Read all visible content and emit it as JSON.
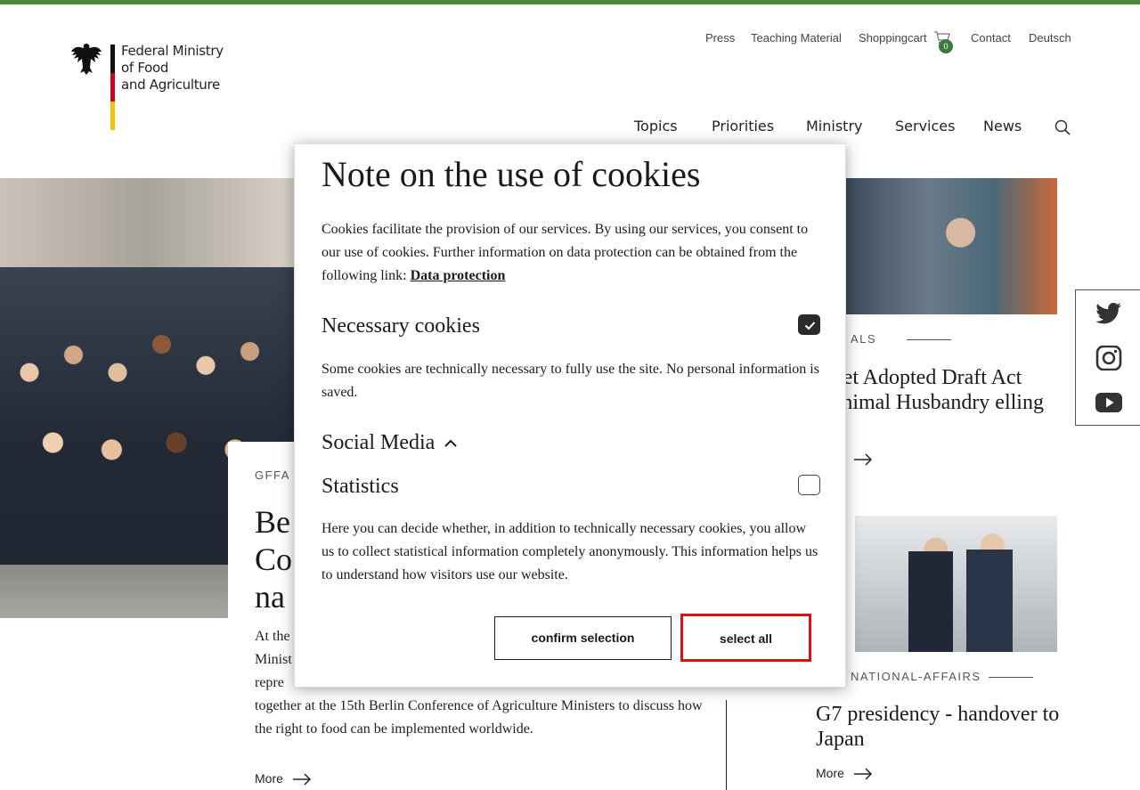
{
  "header": {
    "logo_lines": [
      "Federal Ministry",
      "of Food",
      "and Agriculture"
    ],
    "meta_nav": [
      "Press",
      "Teaching Material",
      "Shoppingcart",
      "Contact",
      "Deutsch"
    ],
    "cart_count": "0",
    "main_nav": [
      "Topics",
      "Priorities",
      "Ministry",
      "Services",
      "News"
    ]
  },
  "main_story": {
    "kicker": "GFFA",
    "title_fragments": [
      "Be",
      "Co",
      "na"
    ],
    "text_fragments": [
      "At the",
      "Minist",
      "repre"
    ],
    "text_tail": "together at the 15th Berlin Conference of Agriculture Ministers to discuss how the right to food can be implemented worldwide.",
    "more_label": "More"
  },
  "side_stories": [
    {
      "kicker": "ALS",
      "title": "inet Adopted Draft Act Animal Husbandry elling"
    },
    {
      "kicker": "NATIONAL-AFFAIRS",
      "title": "G7 presidency - handover to Japan",
      "more_label": "More"
    }
  ],
  "social": [
    "twitter-icon",
    "instagram-icon",
    "youtube-icon"
  ],
  "cookie_dialog": {
    "title": "Note on the use of cookies",
    "intro": "Cookies facilitate the provision of our services. By using our services, you consent to our use of cookies. Further information on data protection can be obtained from the following link:",
    "link_label": "Data protection",
    "necessary": {
      "heading": "Necessary cookies",
      "text": "Some cookies are technically necessary to fully use the site. No personal information is saved.",
      "checked": true
    },
    "social_media": {
      "heading": "Social Media"
    },
    "statistics": {
      "heading": "Statistics",
      "text": "Here you can decide whether, in addition to technically necessary cookies, you allow us to collect statistical information completely anonymously. This information helps us to understand how visitors use our website.",
      "checked": false
    },
    "confirm_label": "confirm selection",
    "select_all_label": "select all"
  },
  "colors": {
    "accent_green": "#4a8a3a",
    "badge_green": "#3d7a3b",
    "highlight_red": "#e01010"
  }
}
